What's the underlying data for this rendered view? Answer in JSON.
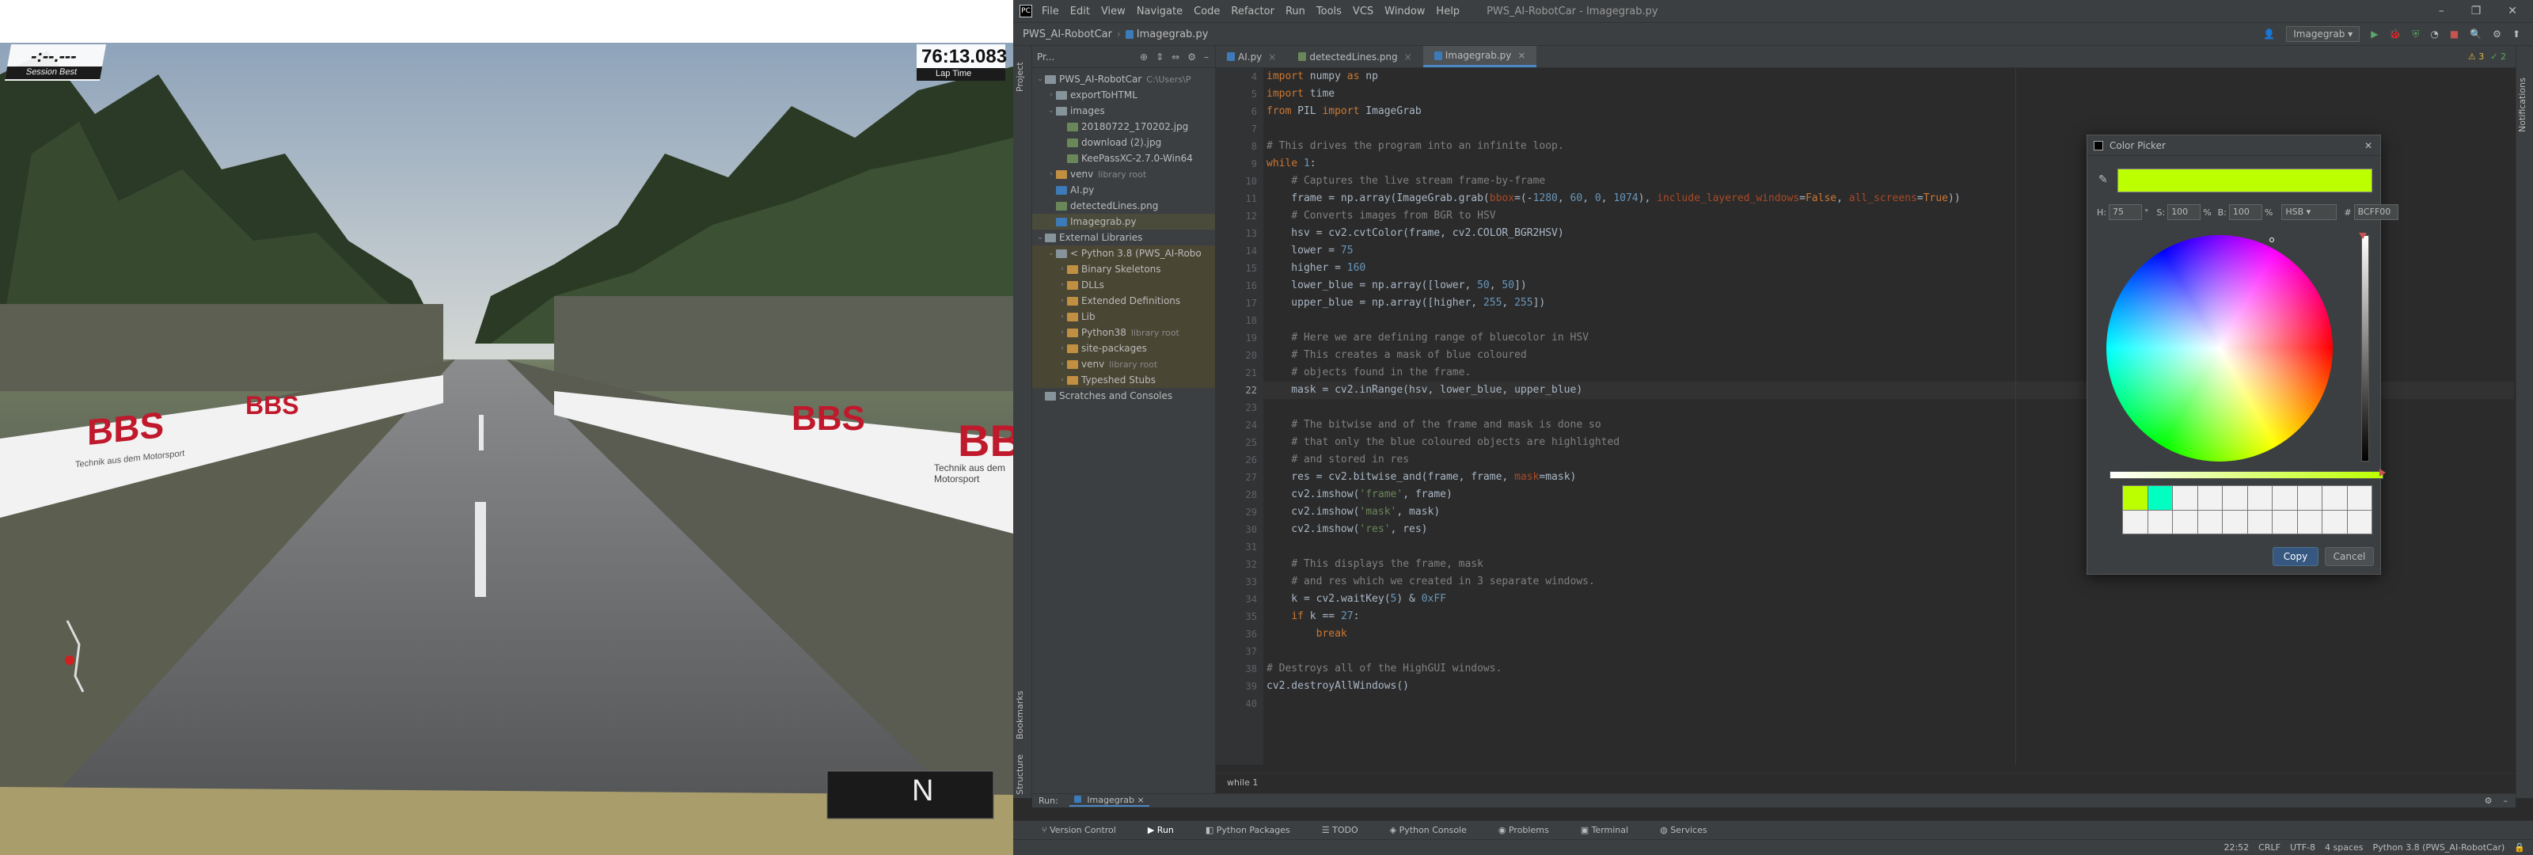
{
  "game": {
    "session_best_value": "-:--.---",
    "session_best_label": "Session Best",
    "lap_time_value": "76:13.083",
    "lap_time_label": "Lap Time",
    "gear": "N",
    "banner_brand": "BBS",
    "banner_slogan": "Technik aus dem Motorsport"
  },
  "ide": {
    "menu": [
      "File",
      "Edit",
      "View",
      "Navigate",
      "Code",
      "Refactor",
      "Run",
      "Tools",
      "VCS",
      "Window",
      "Help"
    ],
    "window_title": "PWS_AI-RobotCar - Imagegrab.py",
    "breadcrumb_project": "PWS_AI-RobotCar",
    "breadcrumb_file": "Imagegrab.py",
    "run_config": "Imagegrab",
    "left_tabs": [
      "Project",
      "Structure",
      "Bookmarks"
    ],
    "right_tabs": [
      "Notifications"
    ],
    "project_header": "Pr...",
    "project_tree": [
      {
        "indent": 0,
        "fold": "⌄",
        "type": "folder",
        "label": "PWS_AI-RobotCar",
        "note": "C:\\Users\\P"
      },
      {
        "indent": 1,
        "fold": "›",
        "type": "folder",
        "label": "exportToHTML",
        "note": ""
      },
      {
        "indent": 1,
        "fold": "⌄",
        "type": "folder",
        "label": "images",
        "note": ""
      },
      {
        "indent": 2,
        "fold": "",
        "type": "image",
        "label": "20180722_170202.jpg",
        "note": ""
      },
      {
        "indent": 2,
        "fold": "",
        "type": "image",
        "label": "download (2).jpg",
        "note": ""
      },
      {
        "indent": 2,
        "fold": "",
        "type": "image",
        "label": "KeePassXC-2.7.0-Win64",
        "note": ""
      },
      {
        "indent": 1,
        "fold": "›",
        "type": "folder-exc",
        "label": "venv",
        "note": "library root"
      },
      {
        "indent": 1,
        "fold": "",
        "type": "py",
        "label": "AI.py",
        "note": ""
      },
      {
        "indent": 1,
        "fold": "",
        "type": "image",
        "label": "detectedLines.png",
        "note": ""
      },
      {
        "indent": 1,
        "fold": "",
        "type": "py",
        "label": "Imagegrab.py",
        "note": ""
      },
      {
        "indent": 0,
        "fold": "⌄",
        "type": "folder",
        "label": "External Libraries",
        "note": ""
      },
      {
        "indent": 1,
        "fold": "⌄",
        "type": "folder",
        "label": "< Python 3.8 (PWS_AI-Robo",
        "note": ""
      },
      {
        "indent": 2,
        "fold": "›",
        "type": "folder-exc",
        "label": "Binary Skeletons",
        "note": ""
      },
      {
        "indent": 2,
        "fold": "›",
        "type": "folder-exc",
        "label": "DLLs",
        "note": ""
      },
      {
        "indent": 2,
        "fold": "›",
        "type": "folder-exc",
        "label": "Extended Definitions",
        "note": ""
      },
      {
        "indent": 2,
        "fold": "›",
        "type": "folder-exc",
        "label": "Lib",
        "note": ""
      },
      {
        "indent": 2,
        "fold": "›",
        "type": "folder-exc",
        "label": "Python38",
        "note": "library root"
      },
      {
        "indent": 2,
        "fold": "›",
        "type": "folder-exc",
        "label": "site-packages",
        "note": ""
      },
      {
        "indent": 2,
        "fold": "›",
        "type": "folder-exc",
        "label": "venv",
        "note": "library root"
      },
      {
        "indent": 2,
        "fold": "›",
        "type": "folder-exc",
        "label": "Typeshed Stubs",
        "note": ""
      },
      {
        "indent": 0,
        "fold": "",
        "type": "folder",
        "label": "Scratches and Consoles",
        "note": ""
      }
    ],
    "tabs": [
      {
        "label": "AI.py",
        "active": false
      },
      {
        "label": "detectedLines.png",
        "active": false
      },
      {
        "label": "Imagegrab.py",
        "active": true
      }
    ],
    "inspection": {
      "warnings": "3",
      "weak": "2"
    },
    "code": [
      {
        "n": "4",
        "html": "<span class=\"k\">import</span> numpy <span class=\"k\">as</span> np"
      },
      {
        "n": "5",
        "html": "<span class=\"k\">import</span> time"
      },
      {
        "n": "6",
        "html": "<span class=\"k\">from</span> PIL <span class=\"k\">import</span> ImageGrab"
      },
      {
        "n": "7",
        "html": ""
      },
      {
        "n": "8",
        "html": "<span class=\"c\"># This drives the program into an infinite loop.</span>"
      },
      {
        "n": "9",
        "html": "<span class=\"k\">while</span> <span class=\"n\">1</span>:"
      },
      {
        "n": "10",
        "html": "    <span class=\"c\"># Captures the live stream frame-by-frame</span>"
      },
      {
        "n": "11",
        "html": "    frame = np.array(ImageGrab.grab(<span class=\"kw\">bbox</span>=(-<span class=\"n\">1280</span>, <span class=\"n\">60</span>, <span class=\"n\">0</span>, <span class=\"n\">1074</span>), <span class=\"kw\">include_layered_windows</span>=<span class=\"k\">False</span>, <span class=\"kw\">all_screens</span>=<span class=\"k\">True</span>))"
      },
      {
        "n": "12",
        "html": "    <span class=\"c\"># Converts images from BGR to HSV</span>"
      },
      {
        "n": "13",
        "html": "    hsv = cv2.cvtColor(frame, cv2.COLOR_BGR2HSV)"
      },
      {
        "n": "14",
        "html": "    lower = <span class=\"n\">75</span>"
      },
      {
        "n": "15",
        "html": "    higher = <span class=\"n\">160</span>"
      },
      {
        "n": "16",
        "html": "    lower_blue = np.array([lower, <span class=\"n\">50</span>, <span class=\"n\">50</span>])"
      },
      {
        "n": "17",
        "html": "    upper_blue = np.array([higher, <span class=\"n\">255</span>, <span class=\"n\">255</span>])"
      },
      {
        "n": "18",
        "html": ""
      },
      {
        "n": "19",
        "html": "    <span class=\"c\"># Here we are defining range of bluecolor in HSV</span>"
      },
      {
        "n": "20",
        "html": "    <span class=\"c\"># This creates a mask of blue coloured</span>"
      },
      {
        "n": "21",
        "html": "    <span class=\"c\"># objects found in the frame.</span>"
      },
      {
        "n": "22",
        "html": "    mask = cv2.inRange(hsv, lower_blue, upper_blue)"
      },
      {
        "n": "23",
        "html": ""
      },
      {
        "n": "24",
        "html": "    <span class=\"c\"># The bitwise and of the frame and mask is done so</span>"
      },
      {
        "n": "25",
        "html": "    <span class=\"c\"># that only the blue coloured objects are highlighted</span>"
      },
      {
        "n": "26",
        "html": "    <span class=\"c\"># and stored in res</span>"
      },
      {
        "n": "27",
        "html": "    res = cv2.bitwise_and(frame, frame, <span class=\"kw\">mask</span>=mask)"
      },
      {
        "n": "28",
        "html": "    cv2.imshow(<span class=\"s\">'frame'</span>, frame)"
      },
      {
        "n": "29",
        "html": "    cv2.imshow(<span class=\"s\">'mask'</span>, mask)"
      },
      {
        "n": "30",
        "html": "    cv2.imshow(<span class=\"s\">'res'</span>, res)"
      },
      {
        "n": "31",
        "html": ""
      },
      {
        "n": "32",
        "html": "    <span class=\"c\"># This displays the frame, mask</span>"
      },
      {
        "n": "33",
        "html": "    <span class=\"c\"># and res which we created in 3 separate windows.</span>"
      },
      {
        "n": "34",
        "html": "    k = cv2.waitKey(<span class=\"n\">5</span>) &amp; <span class=\"n\">0xFF</span>"
      },
      {
        "n": "35",
        "html": "    <span class=\"k\">if</span> k == <span class=\"n\">27</span>:"
      },
      {
        "n": "36",
        "html": "        <span class=\"k\">break</span>"
      },
      {
        "n": "37",
        "html": ""
      },
      {
        "n": "38",
        "html": "<span class=\"c\"># Destroys all of the HighGUI windows.</span>"
      },
      {
        "n": "39",
        "html": "cv2.destroyAllWindows()"
      },
      {
        "n": "40",
        "html": ""
      }
    ],
    "current_line": "22",
    "editor_breadcrumb": "while 1",
    "run_label": "Run:",
    "run_tab": "Imagegrab",
    "bottom_tools": [
      "Version Control",
      "Run",
      "Python Packages",
      "TODO",
      "Python Console",
      "Problems",
      "Terminal",
      "Services"
    ],
    "status": {
      "position": "22:52",
      "line_sep": "CRLF",
      "encoding": "UTF-8",
      "indent": "4 spaces",
      "interpreter": "Python 3.8 (PWS_AI-RobotCar)"
    }
  },
  "color_picker": {
    "title": "Color Picker",
    "color": "#BCFF00",
    "h_label": "H:",
    "h_value": "75",
    "h_unit": "°",
    "s_label": "S:",
    "s_value": "100",
    "s_unit": "%",
    "b_label": "B:",
    "b_value": "100",
    "b_unit": "%",
    "mode": "HSB",
    "hex_label": "#",
    "hex_value": "BCFF00",
    "recent": [
      "#bcff00",
      "#00ffc0"
    ],
    "copy_label": "Copy",
    "cancel_label": "Cancel"
  }
}
